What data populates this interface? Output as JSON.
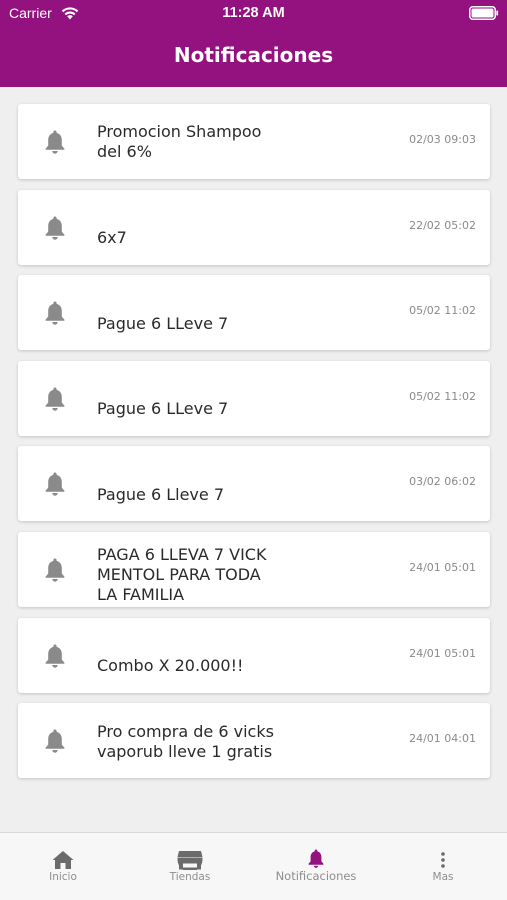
{
  "status_bar": {
    "carrier": "Carrier",
    "time": "11:28 AM"
  },
  "header": {
    "title": "Notificaciones"
  },
  "notifications": [
    {
      "message": "Promocion Shampoo\ndel 6%",
      "date": "02/03 09:03"
    },
    {
      "message": "6x7",
      "date": "22/02 05:02"
    },
    {
      "message": "Pague 6 LLeve 7",
      "date": "05/02 11:02"
    },
    {
      "message": "Pague 6 LLeve 7",
      "date": "05/02 11:02"
    },
    {
      "message": "Pague 6  Lleve 7",
      "date": "03/02 06:02"
    },
    {
      "message": "PAGA 6 LLEVA 7 VICK\nMENTOL PARA TODA\nLA FAMILIA",
      "date": "24/01 05:01"
    },
    {
      "message": "Combo X 20.000!!",
      "date": "24/01 05:01"
    },
    {
      "message": "Pro compra de 6 vicks\nvaporub lleve 1 gratis",
      "date": "24/01 04:01"
    }
  ],
  "tabs": [
    {
      "label": "Inicio",
      "icon": "home-icon"
    },
    {
      "label": "Tiendas",
      "icon": "store-icon"
    },
    {
      "label": "Notificaciones",
      "icon": "bell-icon",
      "active": true
    },
    {
      "label": "Mas",
      "icon": "more-vertical-icon"
    }
  ],
  "colors": {
    "brand": "#94127f",
    "bell_gray": "#8a8a8a",
    "background": "#efeff0"
  }
}
